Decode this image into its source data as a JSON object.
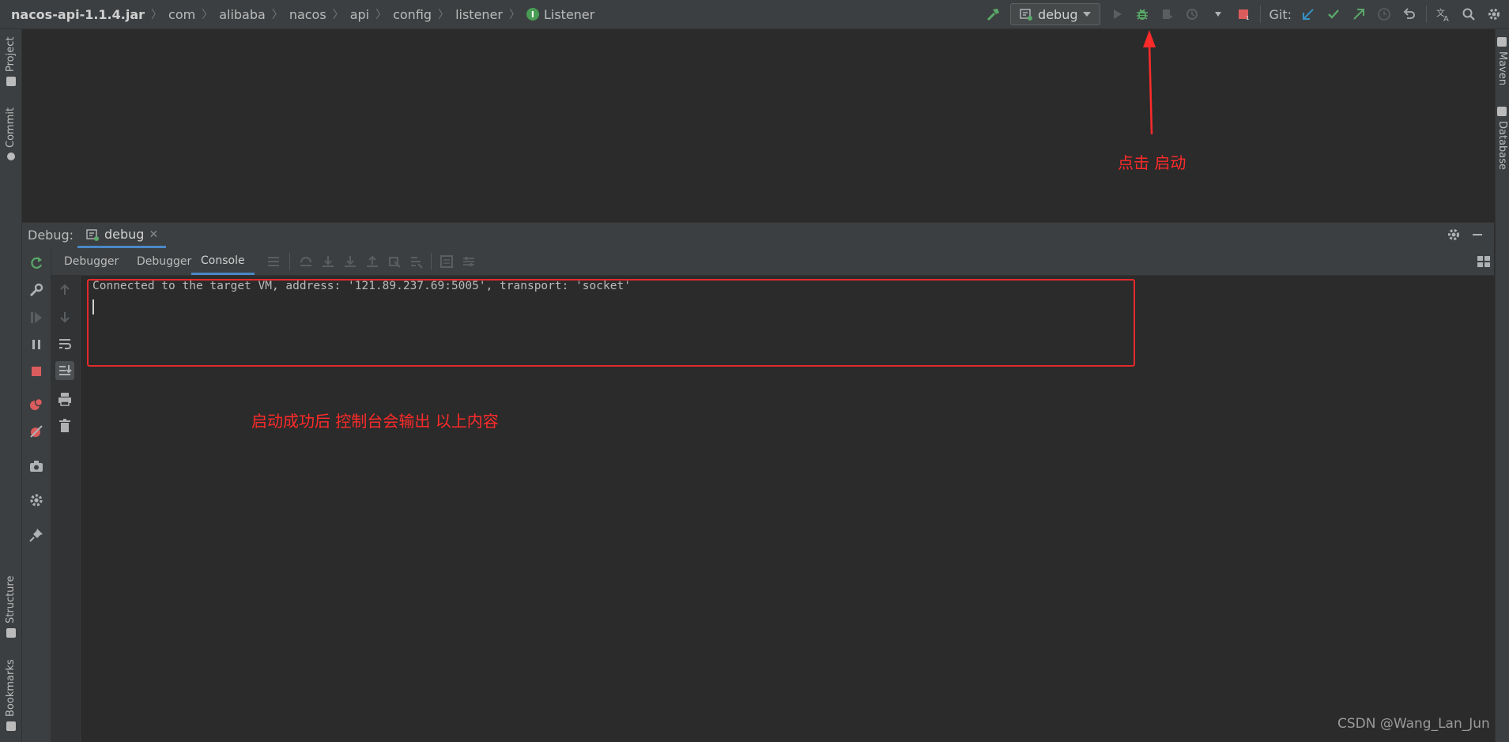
{
  "breadcrumb": {
    "jar": "nacos-api-1.1.4.jar",
    "items": [
      "com",
      "alibaba",
      "nacos",
      "api",
      "config",
      "listener"
    ],
    "current": "Listener",
    "current_badge": "I"
  },
  "toolbar": {
    "run_config": "debug",
    "git_label": "Git:"
  },
  "left_tabs": {
    "project": "Project",
    "commit": "Commit",
    "structure": "Structure",
    "bookmarks": "Bookmarks"
  },
  "right_tabs": {
    "maven": "Maven",
    "database": "Database"
  },
  "debug_panel": {
    "label": "Debug:",
    "tab": "debug",
    "subtabs": [
      "Debugger",
      "Debugger",
      "Console"
    ],
    "active_subtab": "Console"
  },
  "console": {
    "line1": "Connected to the target VM, address: '121.89.237.69:5005', transport: 'socket'"
  },
  "annotations": {
    "start_hint": "点击 启动",
    "console_hint": "启动成功后 控制台会输出 以上内容",
    "watermark": "CSDN @Wang_Lan_Jun"
  },
  "colors": {
    "accent": "#4a88c7",
    "annotation": "#ff2a2a",
    "background": "#2b2b2b",
    "panel": "#3c3f41"
  }
}
